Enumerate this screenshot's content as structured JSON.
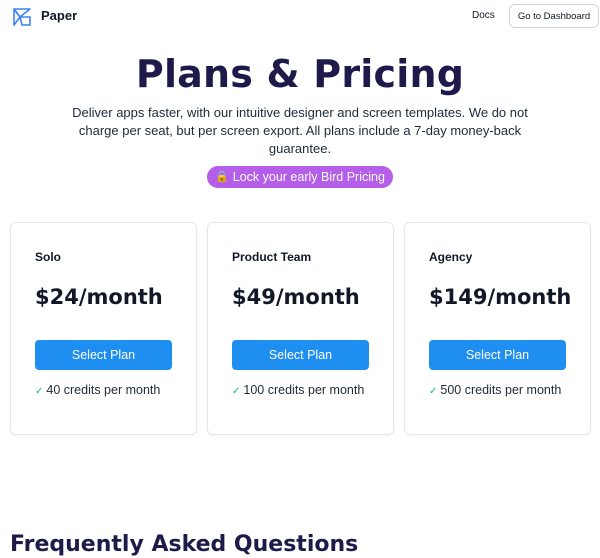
{
  "header": {
    "brand": "Paper",
    "logo_icon": "paper-logo-icon",
    "docs_label": "Docs",
    "dashboard_label": "Go to Dashboard"
  },
  "hero": {
    "title": "Plans & Pricing",
    "subtitle": "Deliver apps faster, with our intuitive designer and screen templates. We do not charge per seat, but per screen export. All plans include a 7-day money-back guarantee.",
    "pill_icon": "lock-icon",
    "pill_label": "Lock your early Bird Pricing"
  },
  "plans": [
    {
      "name": "Solo",
      "price": "$24/month",
      "button": "Select Plan",
      "feature": "40 credits per month"
    },
    {
      "name": "Product Team",
      "price": "$49/month",
      "button": "Select Plan",
      "feature": "100 credits per month"
    },
    {
      "name": "Agency",
      "price": "$149/month",
      "button": "Select Plan",
      "feature": "500 credits per month"
    }
  ],
  "faq": {
    "title": "Frequently Asked Questions"
  },
  "colors": {
    "title": "#1e1b4b",
    "accent_blue": "#1f8ef1",
    "pill_purple": "#b45eea",
    "check_green": "#10b981"
  }
}
